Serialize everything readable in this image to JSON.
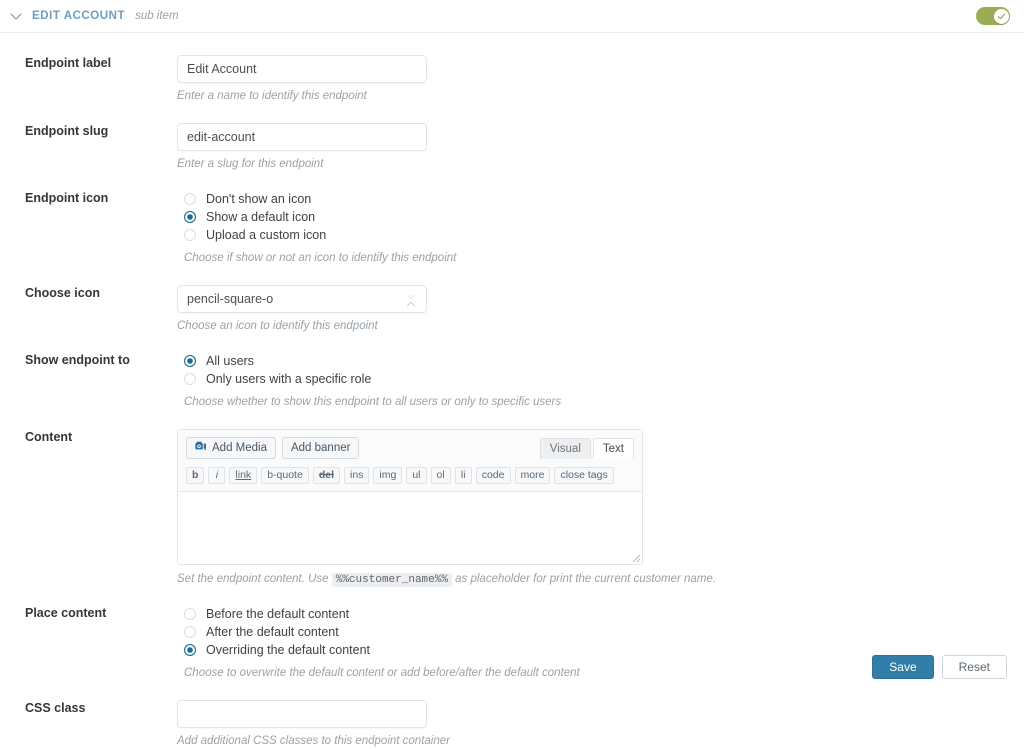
{
  "header": {
    "title": "EDIT ACCOUNT",
    "subtitle": "sub item",
    "collapse_icon": "chevron-down-icon",
    "enabled_toggle": {
      "state": "on",
      "color": "#9aad54",
      "icon": "check-icon"
    }
  },
  "fields": {
    "endpoint_label": {
      "label": "Endpoint label",
      "value": "Edit Account",
      "placeholder": "",
      "help": "Enter a name to identify this endpoint"
    },
    "endpoint_slug": {
      "label": "Endpoint slug",
      "value": "edit-account",
      "placeholder": "",
      "help": "Enter a slug for this endpoint"
    },
    "endpoint_icon": {
      "label": "Endpoint icon",
      "help": "Choose if show or not an icon to identify this endpoint",
      "options": [
        {
          "label": "Don't show an icon",
          "selected": false
        },
        {
          "label": "Show a default icon",
          "selected": true
        },
        {
          "label": "Upload a custom icon",
          "selected": false
        }
      ]
    },
    "choose_icon": {
      "label": "Choose icon",
      "value": "pencil-square-o",
      "help": "Choose an icon to identify this endpoint",
      "options": [
        "pencil-square-o"
      ]
    },
    "show_endpoint_to": {
      "label": "Show endpoint to",
      "help": "Choose whether to show this endpoint to all users or only to specific users",
      "options": [
        {
          "label": "All users",
          "selected": true
        },
        {
          "label": "Only users with a specific role",
          "selected": false
        }
      ]
    },
    "content": {
      "label": "Content",
      "value": "",
      "help_before": "Set the endpoint content. Use",
      "help_code": "%%customer_name%%",
      "help_after": "as placeholder for print the current customer name.",
      "editor": {
        "add_media_label": "Add Media",
        "add_media_icon": "media-camera-icon",
        "add_banner_label": "Add banner",
        "tabs": [
          {
            "label": "Visual",
            "active": false
          },
          {
            "label": "Text",
            "active": true
          }
        ],
        "quicktags": [
          {
            "label": "b",
            "style": "b"
          },
          {
            "label": "i",
            "style": "i"
          },
          {
            "label": "link",
            "style": "link"
          },
          {
            "label": "b-quote",
            "style": ""
          },
          {
            "label": "del",
            "style": "del"
          },
          {
            "label": "ins",
            "style": ""
          },
          {
            "label": "img",
            "style": ""
          },
          {
            "label": "ul",
            "style": ""
          },
          {
            "label": "ol",
            "style": ""
          },
          {
            "label": "li",
            "style": ""
          },
          {
            "label": "code",
            "style": ""
          },
          {
            "label": "more",
            "style": ""
          },
          {
            "label": "close tags",
            "style": ""
          }
        ]
      }
    },
    "place_content": {
      "label": "Place content",
      "help": "Choose to overwrite the default content or add before/after the default content",
      "options": [
        {
          "label": "Before the default content",
          "selected": false
        },
        {
          "label": "After the default content",
          "selected": false
        },
        {
          "label": "Overriding the default content",
          "selected": true
        }
      ]
    },
    "css_class": {
      "label": "CSS class",
      "value": "",
      "placeholder": "",
      "help": "Add additional CSS classes to this endpoint container"
    }
  },
  "footer": {
    "save_label": "Save",
    "reset_label": "Reset"
  },
  "colors": {
    "accent_blue": "#337ea9",
    "header_blue": "#6b9ec4",
    "radio_on": "#1c6b8c",
    "toggle_green": "#9aad54"
  }
}
